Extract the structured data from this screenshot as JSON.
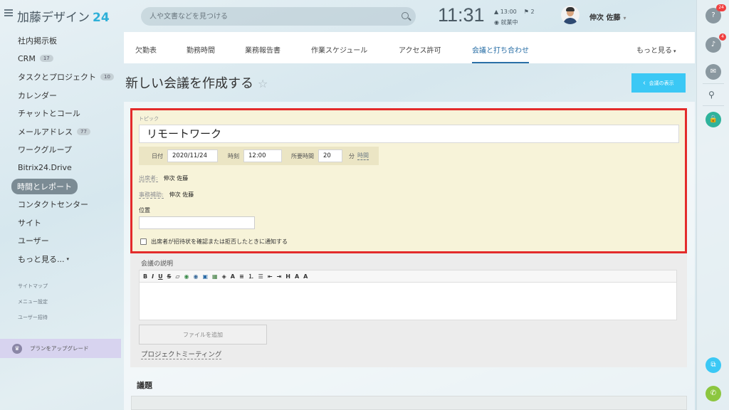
{
  "header": {
    "app_name": "加藤デザイン",
    "app_number": "24",
    "search_placeholder": "人や文書などを見つける",
    "time": "11:31",
    "alarm": "▲ 13:00",
    "flags": "⚑ 2",
    "status": "◉ 就業中",
    "user_name": "伸次 佐藤"
  },
  "sidebar": {
    "items": [
      {
        "label": "社内掲示板"
      },
      {
        "label": "CRM",
        "badge": "17"
      },
      {
        "label": "タスクとプロジェクト",
        "badge": "10"
      },
      {
        "label": "カレンダー"
      },
      {
        "label": "チャットとコール"
      },
      {
        "label": "メールアドレス",
        "badge": "77"
      },
      {
        "label": "ワークグループ"
      },
      {
        "label": "Bitrix24.Drive"
      },
      {
        "label": "時間とレポート"
      },
      {
        "label": "コンタクトセンター"
      },
      {
        "label": "サイト"
      },
      {
        "label": "ユーザー"
      },
      {
        "label": "もっと見る..."
      }
    ],
    "sub_links": [
      "サイトマップ",
      "メニュー設定",
      "ユーザー招待"
    ],
    "upgrade": "プランをアップグレード"
  },
  "tabs": [
    "欠勤表",
    "勤務時間",
    "業務報告書",
    "作業スケジュール",
    "アクセス許可",
    "会議と打ち合わせ",
    "もっと見る"
  ],
  "page": {
    "title": "新しい会議を作成する",
    "back_button": "会議の表示"
  },
  "form": {
    "topic_label": "トピック",
    "topic_value": "リモートワーク",
    "date_label": "日付",
    "date_value": "2020/11/24",
    "time_label": "時刻",
    "time_value": "12:00",
    "duration_label": "所要時間",
    "duration_value": "20",
    "duration_unit": "分",
    "duration_unit_link": "時間",
    "attendees_label": "出席者:",
    "attendees_value": "伸次 佐藤",
    "assistant_label": "事務補助:",
    "assistant_value": "伸次 佐藤",
    "location_label": "位置",
    "location_value": "",
    "notify_label": "出席者が招待状を確認または拒否したときに通知する"
  },
  "description": {
    "label": "会議の説明",
    "toolbar": [
      "B",
      "I",
      "U",
      "S",
      "▱",
      "◉",
      "◉",
      "▣",
      "▦",
      "◈",
      "A",
      "≡",
      "⒈",
      "☰",
      "⇤",
      "⇥",
      "H",
      "A",
      "A"
    ],
    "add_file": "ファイルを追加",
    "project": "プロジェクトミーティング"
  },
  "agenda_label": "議題",
  "rail": {
    "help_count": "24",
    "notif_count": "4"
  }
}
